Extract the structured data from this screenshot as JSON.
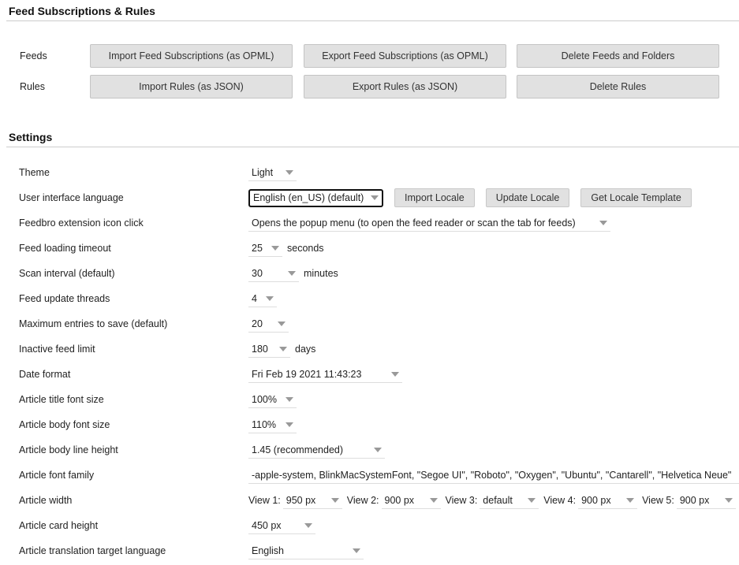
{
  "subscriptions": {
    "title": "Feed Subscriptions & Rules",
    "feeds_label": "Feeds",
    "rules_label": "Rules",
    "import_opml": "Import Feed Subscriptions (as OPML)",
    "export_opml": "Export Feed Subscriptions (as OPML)",
    "delete_feeds": "Delete Feeds and Folders",
    "import_rules": "Import Rules (as JSON)",
    "export_rules": "Export Rules (as JSON)",
    "delete_rules": "Delete Rules"
  },
  "settings": {
    "title": "Settings",
    "theme": {
      "label": "Theme",
      "value": "Light"
    },
    "language": {
      "label": "User interface language",
      "value": "English (en_US) (default)",
      "import": "Import Locale",
      "update": "Update Locale",
      "template": "Get Locale Template"
    },
    "icon_click": {
      "label": "Feedbro extension icon click",
      "value": "Opens the popup menu (to open the feed reader or scan the tab for feeds)"
    },
    "timeout": {
      "label": "Feed loading timeout",
      "value": "25",
      "unit": "seconds"
    },
    "scan": {
      "label": "Scan interval (default)",
      "value": "30",
      "unit": "minutes"
    },
    "threads": {
      "label": "Feed update threads",
      "value": "4"
    },
    "max_entries": {
      "label": "Maximum entries to save (default)",
      "value": "20"
    },
    "inactive": {
      "label": "Inactive feed limit",
      "value": "180",
      "unit": "days"
    },
    "date_format": {
      "label": "Date format",
      "value": "Fri Feb 19 2021 11:43:23"
    },
    "title_size": {
      "label": "Article title font size",
      "value": "100%"
    },
    "body_size": {
      "label": "Article body font size",
      "value": "110%"
    },
    "line_height": {
      "label": "Article body line height",
      "value": "1.45 (recommended)"
    },
    "font_family": {
      "label": "Article font family",
      "value": "-apple-system, BlinkMacSystemFont, \"Segoe UI\", \"Roboto\", \"Oxygen\", \"Ubuntu\", \"Cantarell\", \"Helvetica Neue\""
    },
    "width": {
      "label": "Article width",
      "views": [
        {
          "label": "View 1:",
          "value": "950 px"
        },
        {
          "label": "View 2:",
          "value": "900 px"
        },
        {
          "label": "View 3:",
          "value": "default"
        },
        {
          "label": "View 4:",
          "value": "900 px"
        },
        {
          "label": "View 5:",
          "value": "900 px"
        }
      ]
    },
    "card_height": {
      "label": "Article card height",
      "value": "450 px"
    },
    "translation": {
      "label": "Article translation target language",
      "value": "English"
    }
  }
}
